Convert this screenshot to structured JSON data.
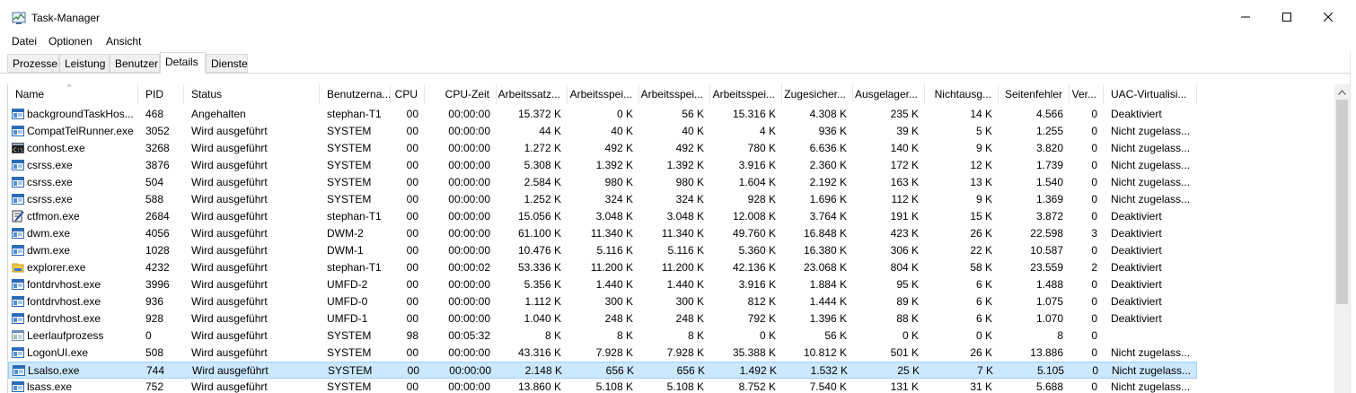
{
  "window": {
    "title": "Task-Manager"
  },
  "menu": [
    "Datei",
    "Optionen",
    "Ansicht"
  ],
  "tabs": [
    "Prozesse",
    "Leistung",
    "Benutzer",
    "Details",
    "Dienste"
  ],
  "active_tab": "Details",
  "columns": [
    "Name",
    "PID",
    "Status",
    "Benutzerna...",
    "CPU",
    "CPU-Zeit",
    "Arbeitssatz...",
    "Arbeitsspei...",
    "Arbeitsspei...",
    "Arbeitsspei...",
    "Zugesicher...",
    "Ausgelager...",
    "Nichtausg...",
    "Seitenfehler",
    "Ver...",
    "UAC-Virtualisi..."
  ],
  "sort": {
    "column": "Name",
    "arrow": "^"
  },
  "rows": [
    [
      "backgroundTaskHos...",
      "468",
      "Angehalten",
      "stephan-T1",
      "00",
      "00:00:00",
      "15.372 K",
      "0 K",
      "56 K",
      "15.316 K",
      "4.308 K",
      "235 K",
      "14 K",
      "4.566",
      "0",
      "Deaktiviert"
    ],
    [
      "CompatTelRunner.exe",
      "3052",
      "Wird ausgeführt",
      "SYSTEM",
      "00",
      "00:00:00",
      "44 K",
      "40 K",
      "40 K",
      "4 K",
      "936 K",
      "39 K",
      "5 K",
      "1.255",
      "0",
      "Nicht zugelass..."
    ],
    [
      "conhost.exe",
      "3268",
      "Wird ausgeführt",
      "SYSTEM",
      "00",
      "00:00:00",
      "1.272 K",
      "492 K",
      "492 K",
      "780 K",
      "6.636 K",
      "140 K",
      "9 K",
      "3.820",
      "0",
      "Nicht zugelass..."
    ],
    [
      "csrss.exe",
      "3876",
      "Wird ausgeführt",
      "SYSTEM",
      "00",
      "00:00:00",
      "5.308 K",
      "1.392 K",
      "1.392 K",
      "3.916 K",
      "2.360 K",
      "172 K",
      "12 K",
      "1.739",
      "0",
      "Nicht zugelass..."
    ],
    [
      "csrss.exe",
      "504",
      "Wird ausgeführt",
      "SYSTEM",
      "00",
      "00:00:00",
      "2.584 K",
      "980 K",
      "980 K",
      "1.604 K",
      "2.192 K",
      "163 K",
      "13 K",
      "1.540",
      "0",
      "Nicht zugelass..."
    ],
    [
      "csrss.exe",
      "588",
      "Wird ausgeführt",
      "SYSTEM",
      "00",
      "00:00:00",
      "1.252 K",
      "324 K",
      "324 K",
      "928 K",
      "1.696 K",
      "112 K",
      "9 K",
      "1.369",
      "0",
      "Nicht zugelass..."
    ],
    [
      "ctfmon.exe",
      "2684",
      "Wird ausgeführt",
      "stephan-T1",
      "00",
      "00:00:00",
      "15.056 K",
      "3.048 K",
      "3.048 K",
      "12.008 K",
      "3.764 K",
      "191 K",
      "15 K",
      "3.872",
      "0",
      "Deaktiviert"
    ],
    [
      "dwm.exe",
      "4056",
      "Wird ausgeführt",
      "DWM-2",
      "00",
      "00:00:00",
      "61.100 K",
      "11.340 K",
      "11.340 K",
      "49.760 K",
      "16.848 K",
      "423 K",
      "26 K",
      "22.598",
      "3",
      "Deaktiviert"
    ],
    [
      "dwm.exe",
      "1028",
      "Wird ausgeführt",
      "DWM-1",
      "00",
      "00:00:00",
      "10.476 K",
      "5.116 K",
      "5.116 K",
      "5.360 K",
      "16.380 K",
      "306 K",
      "22 K",
      "10.587",
      "0",
      "Deaktiviert"
    ],
    [
      "explorer.exe",
      "4232",
      "Wird ausgeführt",
      "stephan-T1",
      "00",
      "00:00:02",
      "53.336 K",
      "11.200 K",
      "11.200 K",
      "42.136 K",
      "23.068 K",
      "804 K",
      "58 K",
      "23.559",
      "2",
      "Deaktiviert"
    ],
    [
      "fontdrvhost.exe",
      "3996",
      "Wird ausgeführt",
      "UMFD-2",
      "00",
      "00:00:00",
      "5.356 K",
      "1.440 K",
      "1.440 K",
      "3.916 K",
      "1.884 K",
      "95 K",
      "6 K",
      "1.488",
      "0",
      "Deaktiviert"
    ],
    [
      "fontdrvhost.exe",
      "936",
      "Wird ausgeführt",
      "UMFD-0",
      "00",
      "00:00:00",
      "1.112 K",
      "300 K",
      "300 K",
      "812 K",
      "1.444 K",
      "89 K",
      "6 K",
      "1.075",
      "0",
      "Deaktiviert"
    ],
    [
      "fontdrvhost.exe",
      "928",
      "Wird ausgeführt",
      "UMFD-1",
      "00",
      "00:00:00",
      "1.040 K",
      "248 K",
      "248 K",
      "792 K",
      "1.396 K",
      "88 K",
      "6 K",
      "1.070",
      "0",
      "Deaktiviert"
    ],
    [
      "Leerlaufprozess",
      "0",
      "Wird ausgeführt",
      "SYSTEM",
      "98",
      "00:05:32",
      "8 K",
      "8 K",
      "8 K",
      "0 K",
      "56 K",
      "0 K",
      "0 K",
      "8",
      "0",
      ""
    ],
    [
      "LogonUI.exe",
      "508",
      "Wird ausgeführt",
      "SYSTEM",
      "00",
      "00:00:00",
      "43.316 K",
      "7.928 K",
      "7.928 K",
      "35.388 K",
      "10.812 K",
      "501 K",
      "26 K",
      "13.886",
      "0",
      "Nicht zugelass..."
    ],
    [
      "Lsalso.exe",
      "744",
      "Wird ausgeführt",
      "SYSTEM",
      "00",
      "00:00:00",
      "2.148 K",
      "656 K",
      "656 K",
      "1.492 K",
      "1.532 K",
      "25 K",
      "7 K",
      "5.105",
      "0",
      "Nicht zugelass..."
    ],
    [
      "lsass.exe",
      "752",
      "Wird ausgeführt",
      "SYSTEM",
      "00",
      "00:00:00",
      "13.860 K",
      "5.108 K",
      "5.108 K",
      "8.752 K",
      "7.540 K",
      "131 K",
      "31 K",
      "5.688",
      "0",
      "Nicht zugelass..."
    ]
  ],
  "row_icons": [
    "window-icon",
    "window-icon",
    "console-icon",
    "window-icon",
    "window-icon",
    "window-icon",
    "ctfmon-icon",
    "window-icon",
    "window-icon",
    "explorer-folder-icon",
    "window-icon",
    "window-icon",
    "window-icon",
    "idle-icon",
    "window-icon",
    "window-icon",
    "window-icon"
  ],
  "selected_row": 15,
  "colors": {
    "selection_bg": "#cce8ff",
    "selection_border": "#99d1ff",
    "scroll_thumb": "#cdcdcd"
  }
}
